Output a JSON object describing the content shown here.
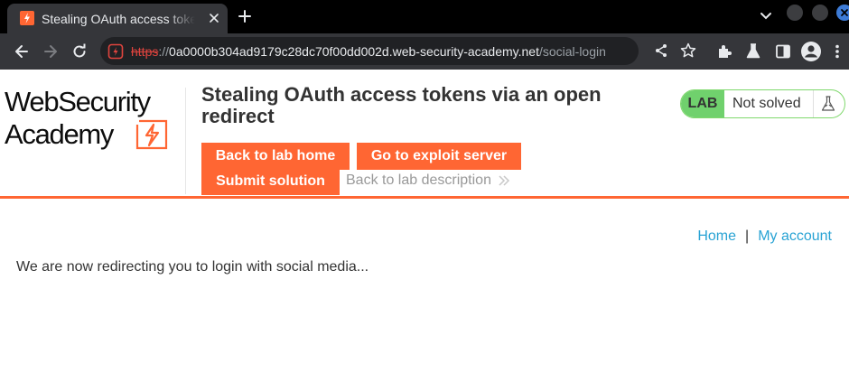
{
  "browser": {
    "tab": {
      "title": "Stealing OAuth access tokens via an open redirect"
    },
    "url": {
      "scheme": "https",
      "separator": "://",
      "host": "0a0000b304ad9179c28dc70f00dd002d.web-security-academy.net",
      "path": "/social-login"
    }
  },
  "header": {
    "logo": {
      "line1": "WebSecurity",
      "line2": "Academy"
    },
    "lab_title": "Stealing OAuth access tokens via an open redirect",
    "buttons": {
      "back_to_lab_home": "Back to lab home",
      "go_to_exploit_server": "Go to exploit server",
      "submit_solution": "Submit solution"
    },
    "description_link": "Back to lab description",
    "lab_status": {
      "pill": "LAB",
      "state": "Not solved"
    }
  },
  "nav": {
    "home": "Home",
    "separator": "|",
    "my_account": "My account"
  },
  "main": {
    "message": "We are now redirecting you to login with social media..."
  },
  "colors": {
    "brand_orange": "#ff6633",
    "lab_green": "#70d16d",
    "link_blue": "#29a3d4"
  }
}
